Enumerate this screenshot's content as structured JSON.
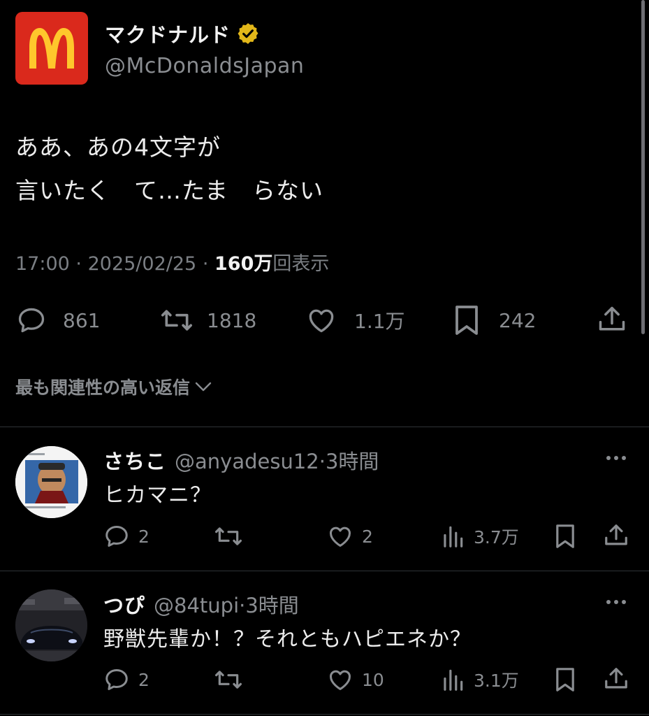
{
  "tweet": {
    "display_name": "マクドナルド",
    "handle": "@McDonaldsJapan",
    "verified_badge_color": "#e2b719",
    "logo_bg": "#da291c",
    "logo_arch_color": "#ffc72c",
    "line1": "ああ、あの4文字が",
    "line2": "言いたく　て…たま　らない",
    "time": "17:00",
    "sep": "·",
    "date": "2025/02/25",
    "views": "160万",
    "views_label": "回表示",
    "replies": "861",
    "retweets": "1818",
    "likes": "1.1万",
    "bookmarks": "242"
  },
  "sort": {
    "label": "最も関連性の高い返信"
  },
  "replies": [
    {
      "name": "さちこ",
      "handle": "@anyadesu12",
      "dot": "·",
      "time": "3時間",
      "text": "ヒカマニ？",
      "reply_count": "2",
      "retweet_count": "",
      "like_count": "2",
      "views": "3.7万"
    },
    {
      "name": "つぴ",
      "handle": "@84tupi",
      "dot": "·",
      "time": "3時間",
      "text": "野獣先輩か！？それともハピエネか？",
      "reply_count": "2",
      "retweet_count": "",
      "like_count": "10",
      "views": "3.1万"
    }
  ],
  "icons": [
    "verified-icon",
    "reply-icon",
    "retweet-icon",
    "like-icon",
    "bookmark-icon",
    "share-icon",
    "views-icon",
    "more-icon",
    "chevron-down-icon"
  ]
}
